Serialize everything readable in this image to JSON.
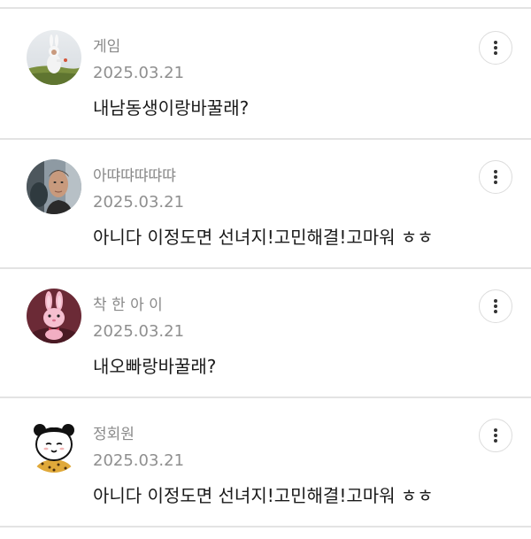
{
  "comments": [
    {
      "author": "게임",
      "date": "2025.03.21",
      "text": "내남동생이랑바꿀래?",
      "avatar": "avatar-bunny-costume-photo",
      "more_icon": "more-vertical-icon"
    },
    {
      "author": "아땨땨땨땨땨",
      "date": "2025.03.21",
      "text": "아니다 이정도면 선녀지!고민해결!고마워 ㅎㅎ",
      "avatar": "avatar-man-portrait-photo",
      "more_icon": "more-vertical-icon"
    },
    {
      "author": "착 한 아 이",
      "date": "2025.03.21",
      "text": "내오빠랑바꿀래?",
      "avatar": "avatar-pink-bunny-plush",
      "more_icon": "more-vertical-icon"
    },
    {
      "author": "정회원",
      "date": "2025.03.21",
      "text": "아니다 이정도면 선녀지!고민해결!고마워 ㅎㅎ",
      "avatar": "avatar-cartoon-bear-character",
      "more_icon": "more-vertical-icon"
    }
  ],
  "colors": {
    "divider": "#e3e3e3",
    "author_text": "#8a8a8a",
    "date_text": "#8f8f8f",
    "body_text": "#1a1a1a"
  }
}
